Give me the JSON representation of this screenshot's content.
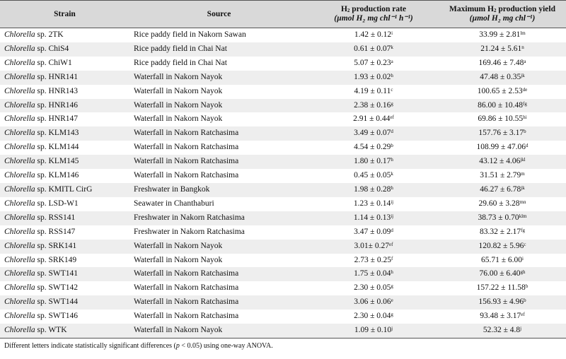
{
  "header": {
    "strain": "Strain",
    "source": "Source",
    "rate_title_pre": "H",
    "rate_title_sub": "2",
    "rate_title_post": " production rate",
    "rate_unit": "(µmol H₂ mg chl⁻¹ h⁻¹)",
    "yield_title_pre": "Maximum H",
    "yield_title_sub": "2",
    "yield_title_post": " production yield",
    "yield_unit": "(µmol H₂ mg chl⁻¹)"
  },
  "rows": [
    {
      "genus": "Chlorella",
      "strain": " sp. 2TK",
      "source": "Rice paddy field in Nakorn Sawan",
      "rate": "1.42 ± 0.12",
      "rate_sup": "i",
      "yield": "33.99 ± 2.81",
      "yield_sup": "lm"
    },
    {
      "genus": "Chlorella",
      "strain": " sp. ChiS4",
      "source": "Rice paddy field in Chai Nat",
      "rate": "0.61 ± 0.07",
      "rate_sup": "k",
      "yield": "21.24 ± 5.61",
      "yield_sup": "n"
    },
    {
      "genus": "Chlorella",
      "strain": " sp. ChiW1",
      "source": "Rice paddy field in Chai Nat",
      "rate": "5.07 ± 0.23",
      "rate_sup": "a",
      "yield": "169.46 ± 7.48",
      "yield_sup": "a"
    },
    {
      "genus": "Chlorella",
      "strain": " sp. HNR141",
      "source": "Waterfall in Nakorn Nayok",
      "rate": "1.93 ± 0.02",
      "rate_sup": "h",
      "yield": "47.48 ± 0.35",
      "yield_sup": "jk"
    },
    {
      "genus": "Chlorella",
      "strain": " sp. HNR143",
      "source": "Waterfall in Nakorn Nayok",
      "rate": "4.19 ± 0.11",
      "rate_sup": "c",
      "yield": "100.65 ± 2.53",
      "yield_sup": "de"
    },
    {
      "genus": "Chlorella",
      "strain": " sp. HNR146",
      "source": "Waterfall in Nakorn Nayok",
      "rate": "2.38 ± 0.16",
      "rate_sup": "g",
      "yield": "86.00 ± 10.48",
      "yield_sup": "fg"
    },
    {
      "genus": "Chlorella",
      "strain": " sp. HNR147",
      "source": "Waterfall in Nakorn Nayok",
      "rate": "2.91 ± 0.44",
      "rate_sup": "ef",
      "yield": "69.86 ± 10.55",
      "yield_sup": "hi"
    },
    {
      "genus": "Chlorella",
      "strain": " sp. KLM143",
      "source": "Waterfall in Nakorn Ratchasima",
      "rate": "3.49 ± 0.07",
      "rate_sup": "d",
      "yield": "157.76 ± 3.17",
      "yield_sup": "b"
    },
    {
      "genus": "Chlorella",
      "strain": " sp. KLM144",
      "source": "Waterfall in Nakorn Ratchasima",
      "rate": "4.54 ± 0.29",
      "rate_sup": "b",
      "yield": "108.99 ± 47.06",
      "yield_sup": "d"
    },
    {
      "genus": "Chlorella",
      "strain": " sp. KLM145",
      "source": "Waterfall in Nakorn Ratchasima",
      "rate": "1.80 ± 0.17",
      "rate_sup": "h",
      "yield": "43.12 ± 4.06",
      "yield_sup": "jkl"
    },
    {
      "genus": "Chlorella",
      "strain": " sp. KLM146",
      "source": "Waterfall in Nakorn Ratchasima",
      "rate": "0.45 ± 0.05",
      "rate_sup": "k",
      "yield": "31.51 ± 2.79",
      "yield_sup": "m"
    },
    {
      "genus": "Chlorella",
      "strain": " sp. KMITL CirG",
      "source": "Freshwater in Bangkok",
      "rate": "1.98 ± 0.28",
      "rate_sup": "h",
      "yield": "46.27 ± 6.78",
      "yield_sup": "jk"
    },
    {
      "genus": "Chlorella",
      "strain": " sp. LSD-W1",
      "source": "Seawater in Chanthaburi",
      "rate": "1.23 ± 0.14",
      "rate_sup": "ij",
      "yield": "29.60 ± 3.28",
      "yield_sup": "mn"
    },
    {
      "genus": "Chlorella",
      "strain": " sp. RSS141",
      "source": "Freshwater in Nakorn Ratchasima",
      "rate": "1.14 ± 0.13",
      "rate_sup": "ij",
      "yield": "38.73 ± 0.70",
      "yield_sup": "klm"
    },
    {
      "genus": "Chlorella",
      "strain": " sp. RSS147",
      "source": "Freshwater in Nakorn Ratchasima",
      "rate": "3.47 ± 0.09",
      "rate_sup": "d",
      "yield": "83.32 ± 2.17",
      "yield_sup": "fg"
    },
    {
      "genus": "Chlorella",
      "strain": " sp. SRK141",
      "source": "Waterfall in Nakorn Nayok",
      "rate": "3.01± 0.27",
      "rate_sup": "ef",
      "yield": "120.82 ± 5.96",
      "yield_sup": "c"
    },
    {
      "genus": "Chlorella",
      "strain": " sp. SRK149",
      "source": "Waterfall in Nakorn Nayok",
      "rate": "2.73 ± 0.25",
      "rate_sup": "f",
      "yield": "65.71 ± 6.00",
      "yield_sup": "i"
    },
    {
      "genus": "Chlorella",
      "strain": " sp. SWT141",
      "source": "Waterfall in Nakorn Ratchasima",
      "rate": "1.75 ± 0.04",
      "rate_sup": "h",
      "yield": "76.00 ± 6.40",
      "yield_sup": "gh"
    },
    {
      "genus": "Chlorella",
      "strain": " sp. SWT142",
      "source": "Waterfall in Nakorn Ratchasima",
      "rate": "2.30 ± 0.05",
      "rate_sup": "g",
      "yield": "157.22 ± 11.58",
      "yield_sup": "b"
    },
    {
      "genus": "Chlorella",
      "strain": " sp. SWT144",
      "source": "Waterfall in Nakorn Ratchasima",
      "rate": "3.06 ± 0.06",
      "rate_sup": "e",
      "yield": "156.93 ± 4.96",
      "yield_sup": "b"
    },
    {
      "genus": "Chlorella",
      "strain": " sp. SWT146",
      "source": "Waterfall in Nakorn Ratchasima",
      "rate": "2.30 ± 0.04",
      "rate_sup": "g",
      "yield": "93.48 ± 3.17",
      "yield_sup": "ef"
    },
    {
      "genus": "Chlorella",
      "strain": " sp. WTK",
      "source": "Waterfall in Nakorn Nayok",
      "rate": "1.09 ± 0.10",
      "rate_sup": "j",
      "yield": "52.32 ± 4.8",
      "yield_sup": "j"
    }
  ],
  "footnote": {
    "pre": "Different letters indicate statistically significant differences (",
    "p": "p",
    "post": " < 0.05) using one-way ANOVA."
  }
}
